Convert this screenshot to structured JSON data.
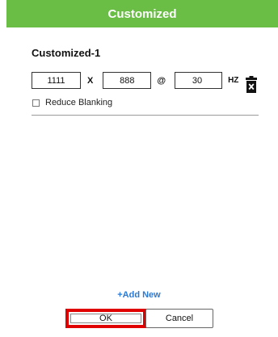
{
  "dialog": {
    "title": "Customized",
    "header_color": "#6abd45"
  },
  "entry": {
    "name": "Customized-1",
    "width_value": "1111",
    "x_label": "X",
    "height_value": "888",
    "at_label": "@",
    "refresh_value": "30",
    "unit_label": "HZ",
    "delete_icon": "trash-icon",
    "reduce_blanking_label": "Reduce Blanking",
    "reduce_blanking_checked": false
  },
  "actions": {
    "add_new_label": "+Add New",
    "ok_label": "OK",
    "cancel_label": "Cancel",
    "ok_highlight_color": "#e10000"
  }
}
